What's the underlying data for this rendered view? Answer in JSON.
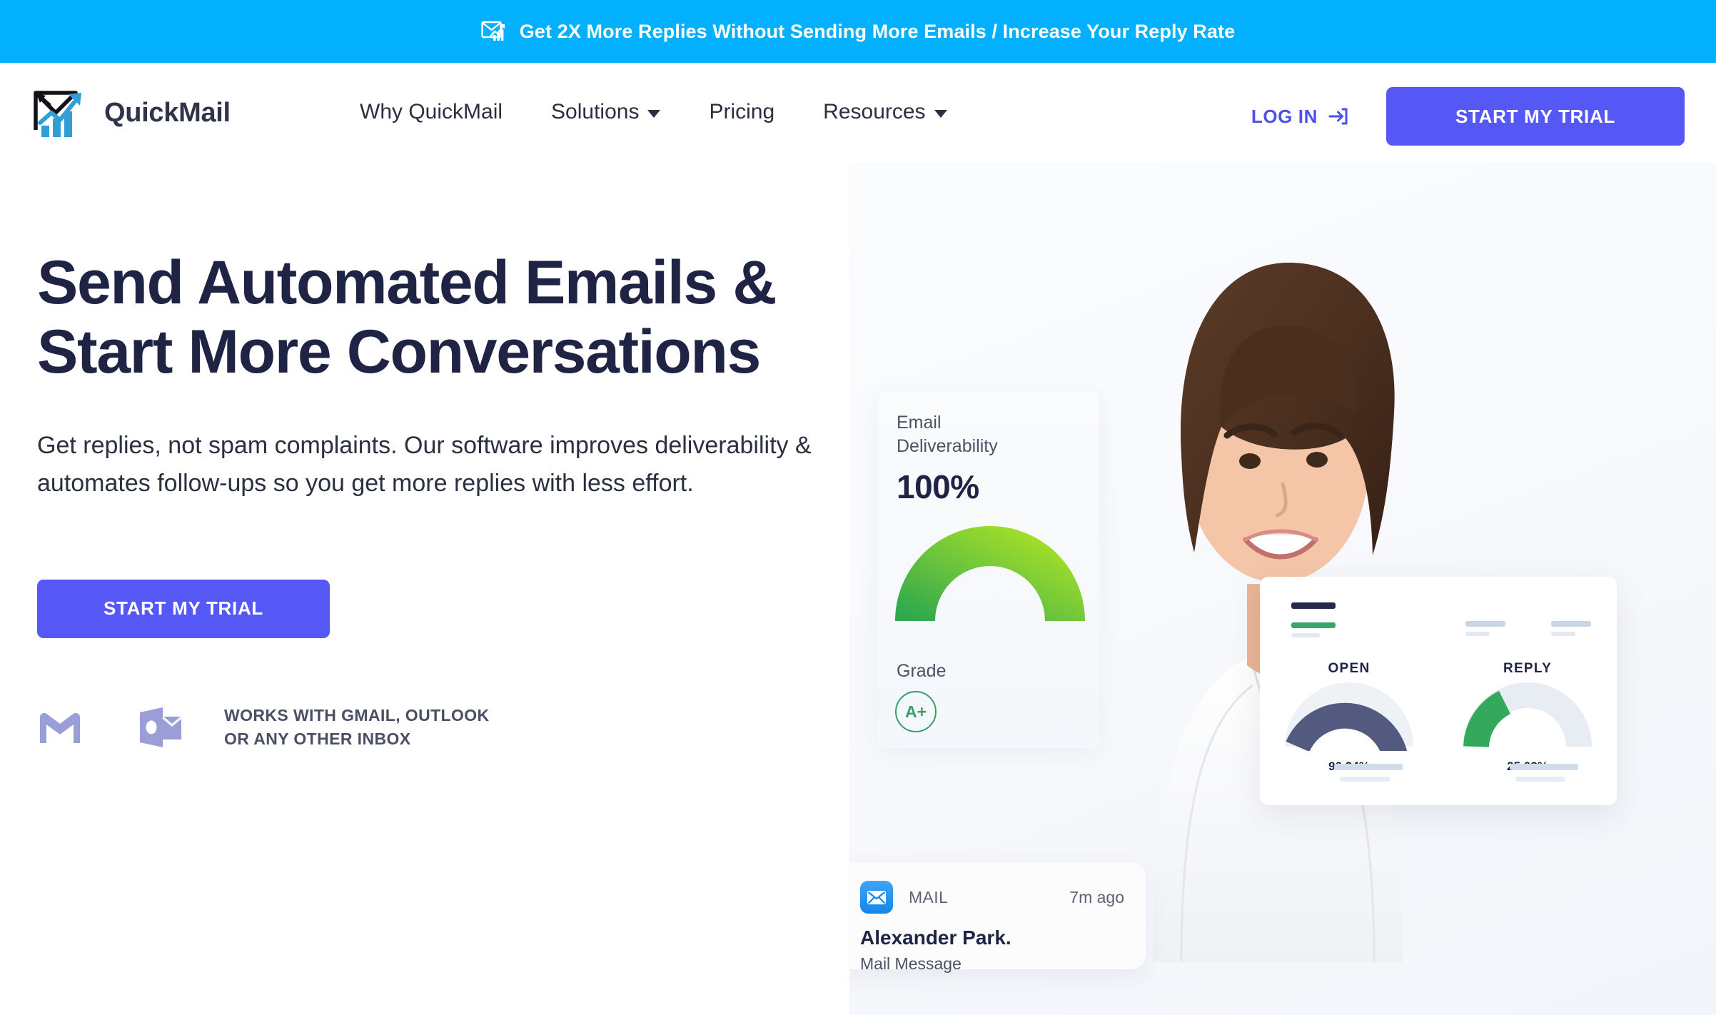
{
  "announcement": {
    "icon": "email-chart-icon",
    "text": "Get 2X More Replies Without Sending More Emails / Increase Your Reply Rate",
    "background_color": "#03b0fd"
  },
  "header": {
    "logo": {
      "icon": "quickmail-logo-icon",
      "text": "QuickMail"
    },
    "nav": [
      {
        "label": "Why QuickMail",
        "has_dropdown": false
      },
      {
        "label": "Solutions",
        "has_dropdown": true
      },
      {
        "label": "Pricing",
        "has_dropdown": false
      },
      {
        "label": "Resources",
        "has_dropdown": true
      }
    ],
    "login": {
      "label": "LOG IN",
      "icon": "login-arrow-icon",
      "color": "#4a52e8"
    },
    "cta": {
      "label": "START MY TRIAL",
      "color": "#5558f5"
    }
  },
  "hero": {
    "headline": "Send Automated Emails & Start More Conversations",
    "subheadline": "Get replies, not spam complaints. Our software improves deliverability & automates follow-ups so you get more replies with less effort.",
    "cta": {
      "label": "START MY TRIAL",
      "color": "#5558f5"
    },
    "works_with": {
      "logos": [
        "gmail-logo-icon",
        "outlook-logo-icon"
      ],
      "line1": "WORKS WITH GMAIL, OUTLOOK",
      "line2": "OR ANY OTHER INBOX"
    }
  },
  "hero_visual": {
    "photo_alt": "smiling-woman-portrait",
    "deliverability_card": {
      "label_line1": "Email",
      "label_line2": "Deliverability",
      "percent": "100%",
      "grade_label": "Grade",
      "grade_value": "A+",
      "gauge_color_start": "#2ea84f",
      "gauge_color_end": "#a6e028"
    },
    "stats_card": {
      "gauges": [
        {
          "title": "OPEN",
          "value": "90.24%",
          "color": "#535a80",
          "fill": 0.9
        },
        {
          "title": "REPLY",
          "value": "25.02%",
          "color": "#34a85b",
          "fill": 0.25
        }
      ]
    },
    "mail_notification": {
      "icon": "mail-app-icon",
      "app": "MAIL",
      "time": "7m ago",
      "title": "Alexander Park.",
      "subtitle": "Mail Message"
    }
  }
}
